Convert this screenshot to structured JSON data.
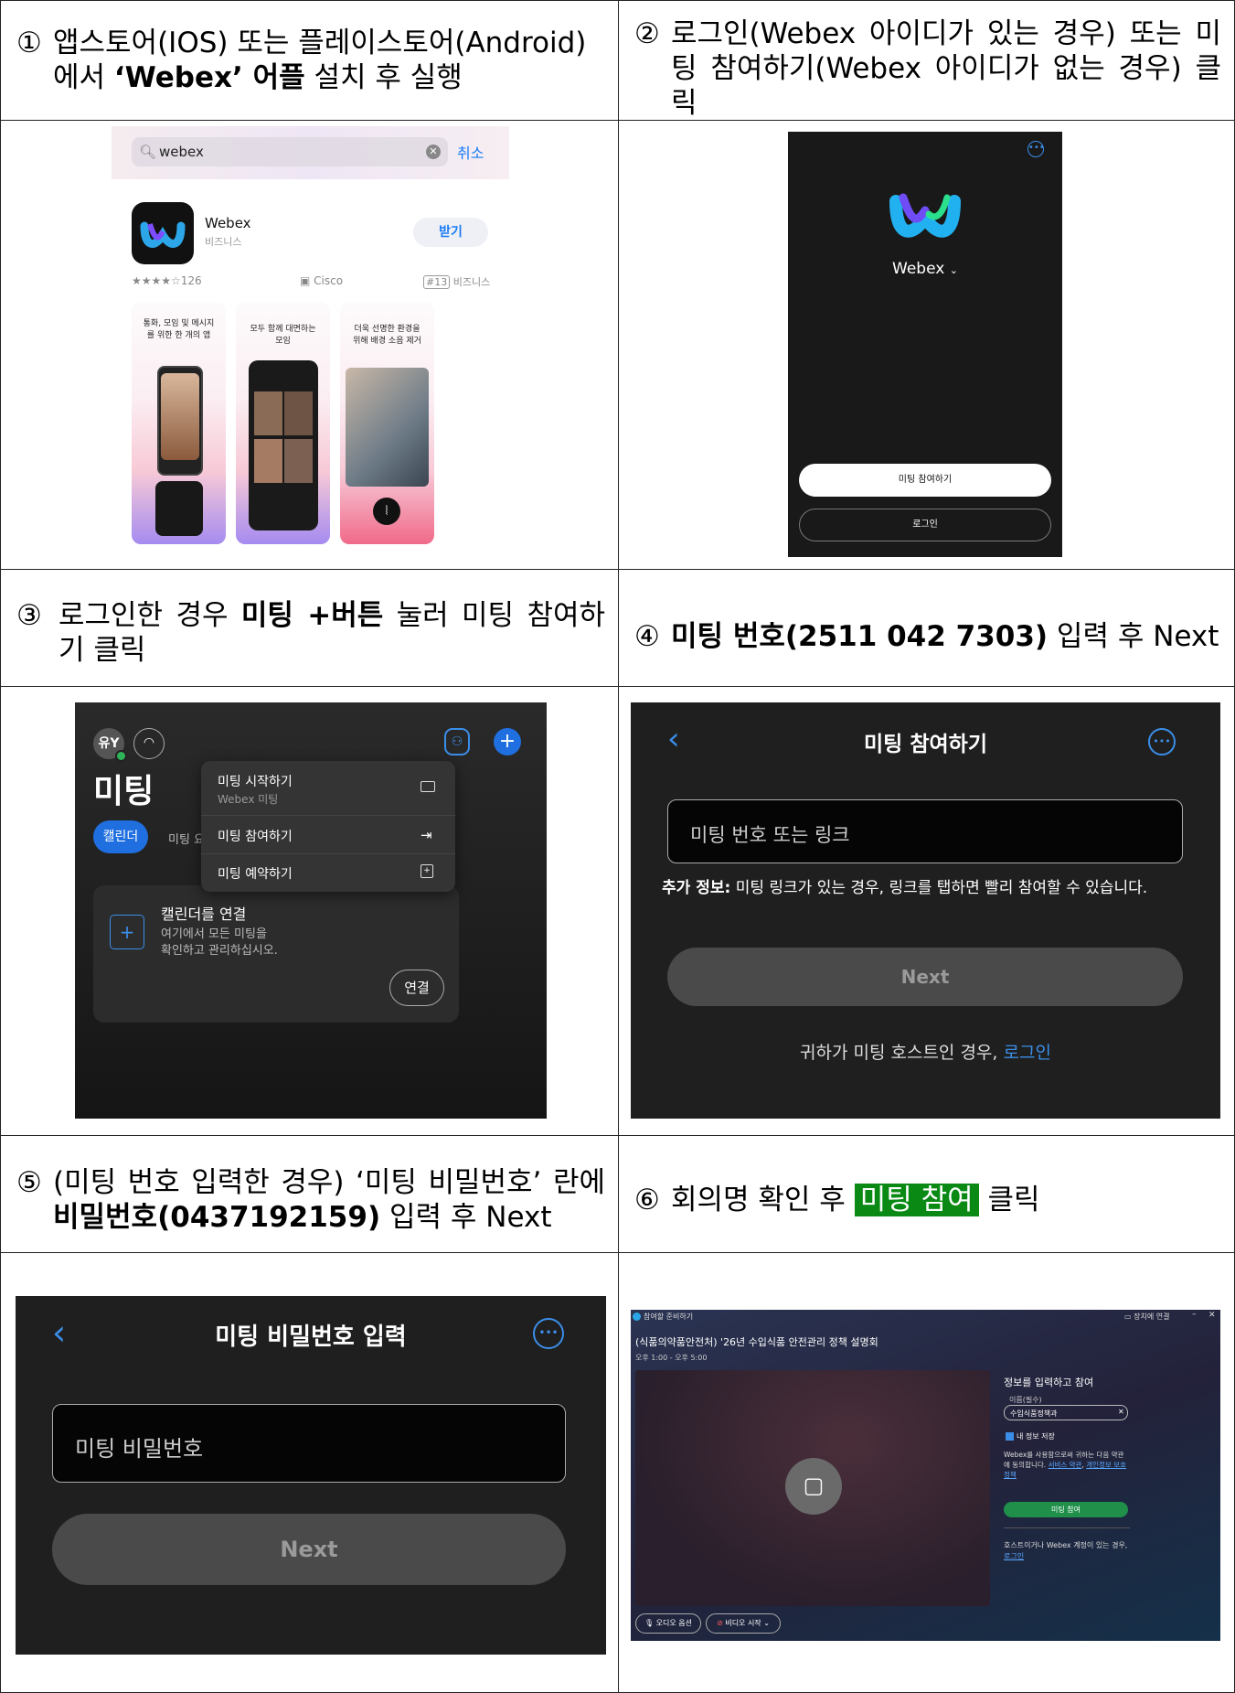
{
  "steps": {
    "s1": {
      "num": "①",
      "pre": "앱스토어(IOS) 또는 플레이스토어(Android)",
      "line2_pre": "에서",
      "bold": "‘Webex’ 어플",
      "post": "설치 후 실행"
    },
    "s2": {
      "num": "②",
      "text": "로그인(Webex 아이디가 있는 경우) 또는 미팅 참여하기(Webex 아이디가 없는 경우) 클릭"
    },
    "s3": {
      "num": "③",
      "pre": "로그인한 경우",
      "bold": "미팅 +버튼",
      "post": "눌러 미팅 참여하기 클릭"
    },
    "s4": {
      "num": "④",
      "bold": "미팅 번호(2511 042 7303)",
      "post": "입력 후 Next"
    },
    "s5": {
      "num": "⑤",
      "pre": "(미팅 번호 입력한 경우) ‘미팅 비밀번호’ 란에",
      "bold": "비밀번호(0437192159)",
      "post": "입력 후 Next"
    },
    "s6": {
      "num": "⑥",
      "pre": "회의명 확인 후",
      "highlight": "미팅 참여",
      "post": "클릭"
    }
  },
  "appstore": {
    "search_value": "webex",
    "cancel": "취소",
    "app_name": "Webex",
    "app_category": "비즈니스",
    "get": "받기",
    "rating": "★★★★☆126",
    "developer": "Cisco",
    "rank": "#13",
    "rank_category": "비즈니스",
    "cards": [
      "통화, 모임 및 메시지\n를 위한 한 개의 앱",
      "모두 함께 대면하는\n모임",
      "더욱 선명한 환경을\n위해 배경 소음 제거"
    ]
  },
  "splash": {
    "brand": "Webex",
    "join": "미팅 참여하기",
    "login": "로그인"
  },
  "meetings": {
    "avatar": "유Y",
    "title": "미팅",
    "tab_calendar": "캘린더",
    "tab_summary": "미팅 요약",
    "menu": [
      {
        "label": "미팅 시작하기",
        "sub": "Webex 미팅"
      },
      {
        "label": "미팅 참여하기",
        "sub": ""
      },
      {
        "label": "미팅 예약하기",
        "sub": ""
      }
    ],
    "connect_title": "캘린더를 연결",
    "connect_desc1": "여기에서 모든 미팅을",
    "connect_desc2": "확인하고 관리하십시오.",
    "connect_btn": "연결"
  },
  "join": {
    "title": "미팅 참여하기",
    "placeholder": "미팅 번호 또는 링크",
    "info_bold": "추가 정보:",
    "info": "미팅 링크가 있는 경우, 링크를 탭하면 빨리 참여할 수 있습니다.",
    "next": "Next",
    "host_text": "귀하가 미팅 호스트인 경우,",
    "host_link": "로그인"
  },
  "password": {
    "title": "미팅 비밀번호 입력",
    "placeholder": "미팅 비밀번호",
    "next": "Next"
  },
  "desktop": {
    "app_title": "참여할 준비하기",
    "device": "장치에 연결",
    "meeting_title": "(식품의약품안전처) '26년 수입식품 안전관리 정책 설명회",
    "time": "오후 1:00 - 오후 5:00",
    "panel_title": "정보를 입력하고 참여",
    "name_label": "이름(필수)",
    "name_value": "수입식품정책과",
    "save_info": "내 정보 저장",
    "terms_pre": "Webex를 사용함으로써 귀하는 다음 약관에 동의합니다.",
    "terms_link1": "서비스 약관",
    "terms_link2": "개인정보 보호정책",
    "join_btn": "미팅 참여",
    "host_note": "호스트이거나 Webex 계정이 있는 경우,",
    "host_link": "로그인",
    "audio": "오디오 옵션",
    "video": "비디오 시작"
  }
}
